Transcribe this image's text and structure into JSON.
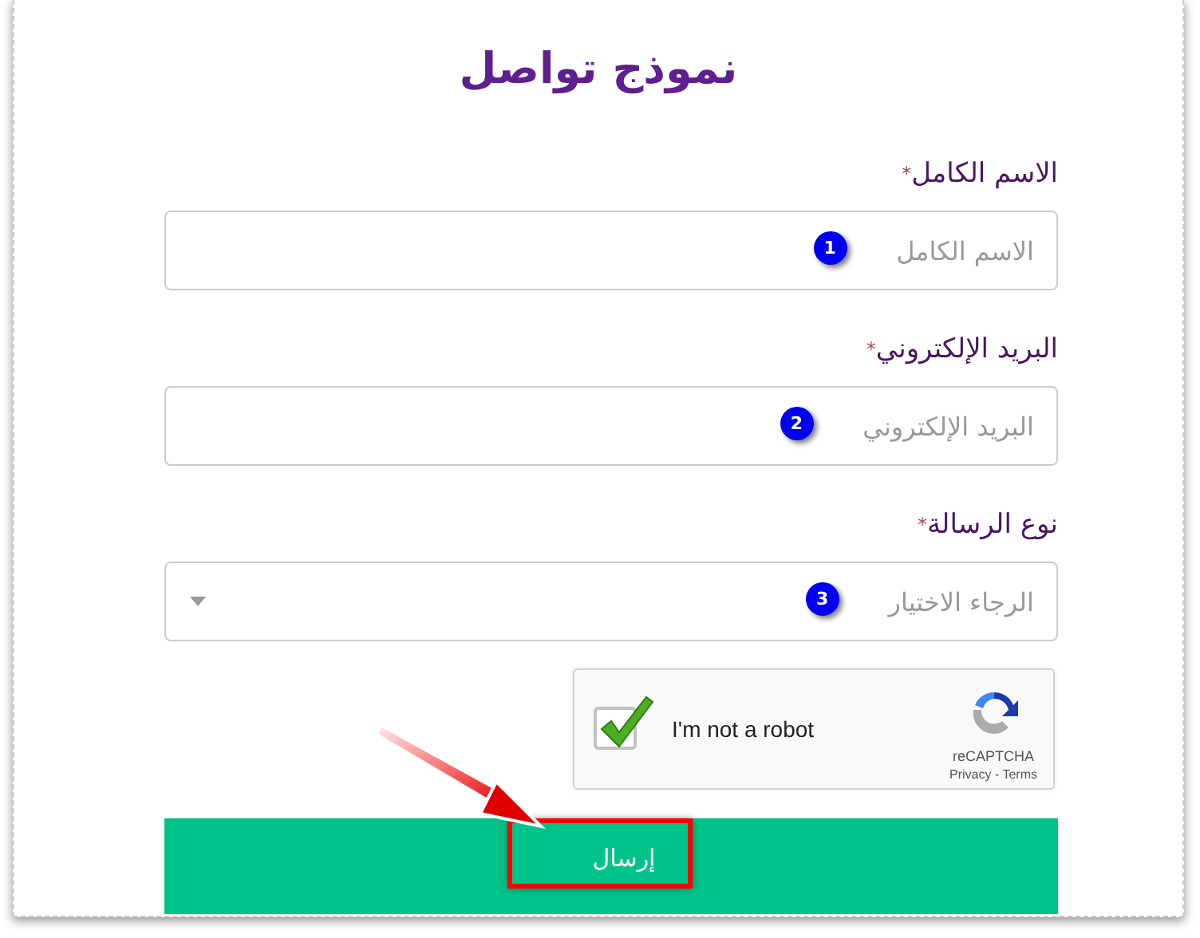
{
  "title": "نموذج تواصل",
  "fields": [
    {
      "kind": "text",
      "label": "الاسم الكامل",
      "required_mark": "*",
      "placeholder": "الاسم الكامل",
      "marker": "1"
    },
    {
      "kind": "text",
      "label": "البريد الإلكتروني",
      "required_mark": "*",
      "placeholder": "البريد الإلكتروني",
      "marker": "2"
    },
    {
      "kind": "select",
      "label": "نوع الرسالة",
      "required_mark": "*",
      "placeholder": "الرجاء الاختيار",
      "marker": "3"
    }
  ],
  "captcha": {
    "label": "I'm not a robot",
    "checked": true,
    "brand": "reCAPTCHA",
    "links": "Privacy - Terms"
  },
  "submit": {
    "label": "إرسال",
    "highlighted": true
  }
}
